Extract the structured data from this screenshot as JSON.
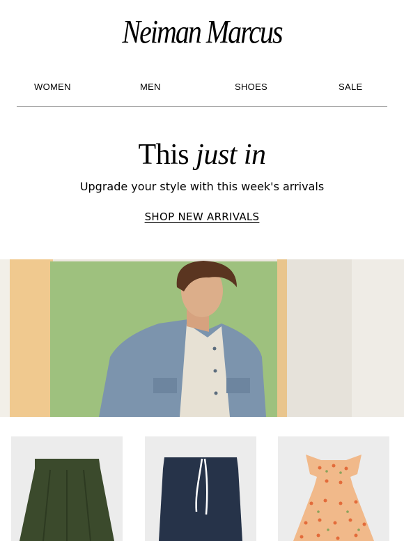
{
  "brand": {
    "logo_text": "Neiman Marcus"
  },
  "nav": {
    "items": [
      "WOMEN",
      "MEN",
      "SHOES",
      "SALE"
    ]
  },
  "promo": {
    "headline_plain": "This",
    "headline_italic": "just in",
    "subline": "Upgrade your style with this week's arrivals",
    "cta_label": "SHOP NEW ARRIVALS"
  },
  "colors": {
    "hero_wall": "#9ec17e",
    "hero_left": "#f0c98f",
    "jacket": "#7c94ad",
    "skirt_green": "#3b4a2c",
    "skirt_navy": "#263349",
    "floral": "#f1b98a"
  },
  "products": [
    {
      "image": "green-pleated-skirt-image"
    },
    {
      "image": "navy-drawstring-skirt-image"
    },
    {
      "image": "floral-dress-image"
    }
  ]
}
